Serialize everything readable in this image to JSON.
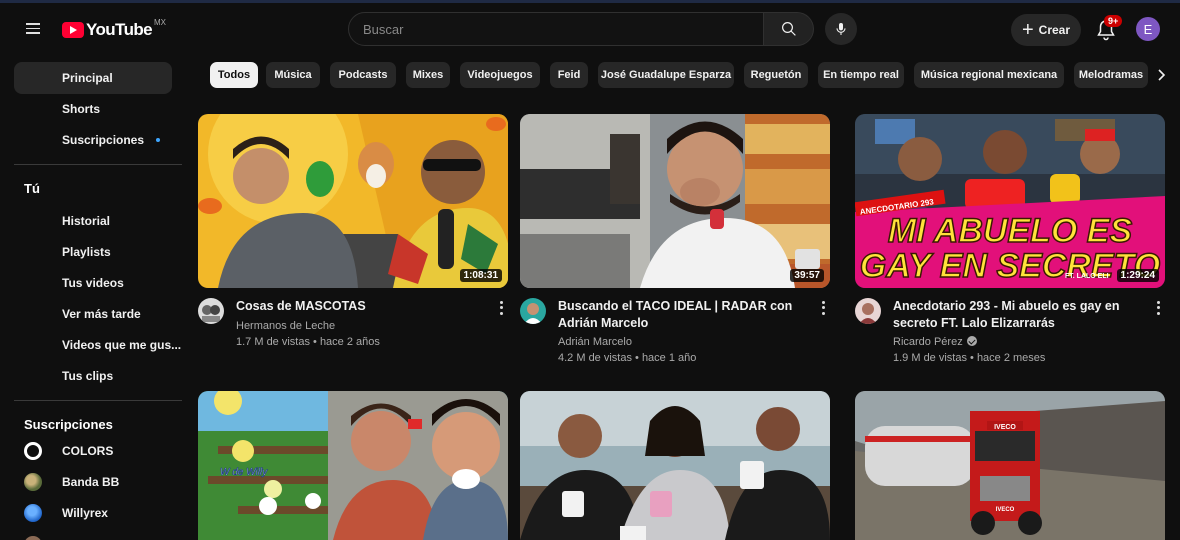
{
  "header": {
    "logo_text": "YouTube",
    "region": "MX",
    "search_placeholder": "Buscar",
    "create_label": "Crear",
    "notifications_badge": "9+",
    "avatar_letter": "E"
  },
  "sidebar": {
    "main": [
      {
        "label": "Principal",
        "active": true
      },
      {
        "label": "Shorts"
      },
      {
        "label": "Suscripciones",
        "new_dot": true
      }
    ],
    "you_heading": "Tú",
    "you": [
      {
        "label": "Historial"
      },
      {
        "label": "Playlists"
      },
      {
        "label": "Tus videos"
      },
      {
        "label": "Ver más tarde"
      },
      {
        "label": "Videos que me gus..."
      },
      {
        "label": "Tus clips"
      }
    ],
    "subs_heading": "Suscripciones",
    "subs": [
      {
        "label": "COLORS",
        "icon": "colors-ring-icon"
      },
      {
        "label": "Banda BB",
        "icon": "banda-bb-avatar"
      },
      {
        "label": "Willyrex",
        "icon": "willyrex-avatar"
      }
    ]
  },
  "chips": [
    "Todos",
    "Música",
    "Podcasts",
    "Mixes",
    "Videojuegos",
    "Feid",
    "José Guadalupe Esparza",
    "Reguetón",
    "En tiempo real",
    "Música regional mexicana",
    "Melodramas"
  ],
  "videos": [
    {
      "title": "Cosas de MASCOTAS",
      "channel": "Hermanos de Leche",
      "meta": "1.7 M de vistas • hace 2 años",
      "duration": "1:08:31",
      "verified": false
    },
    {
      "title": "Buscando el TACO IDEAL | RADAR con Adrián Marcelo",
      "channel": "Adrián Marcelo",
      "meta": "4.2 M de vistas • hace 1 año",
      "duration": "39:57",
      "verified": false
    },
    {
      "title": "Anecdotario 293 - Mi abuelo es gay en secreto FT. Lalo Elizarrarás",
      "channel": "Ricardo Pérez",
      "meta": "1.9 M de vistas • hace 2 meses",
      "duration": "1:29:24",
      "verified": true
    }
  ],
  "thumb_text": {
    "v3_line1": "MI ABUELO ES",
    "v3_line2": "GAY EN SECRETO",
    "v3_tag": "ANECDOTARIO 293",
    "v3_ft": "FT. LALO ELI",
    "v4_sign": "W de Willy",
    "v6_truck": "IVECO",
    "v6_grille": "IVECO"
  },
  "colors": {
    "accent": "#ff0033",
    "chip_active_bg": "#f1f1f1",
    "chip_bg": "#272727",
    "avatar": "#7e57c2",
    "badge": "#cc0000"
  }
}
